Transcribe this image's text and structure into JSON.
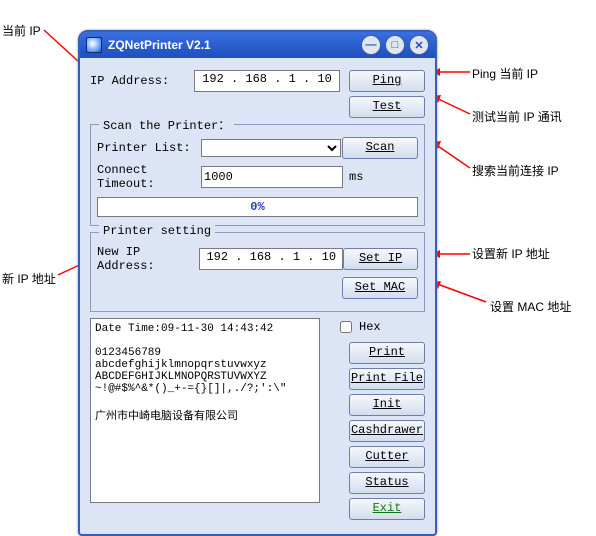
{
  "annotations": {
    "current_ip": "当前 IP",
    "ping_ip": "Ping 当前 IP",
    "test_comm": "测试当前 IP 通讯",
    "scan_ip": "搜索当前连接 IP",
    "new_ip_addr": "新 IP 地址",
    "set_new_ip": "设置新 IP 地址",
    "set_mac": "设置 MAC 地址"
  },
  "window": {
    "title": "ZQNetPrinter V2.1"
  },
  "top": {
    "ip_label": "IP Address:",
    "ip_value": "192 . 168 .  1  .  10",
    "ping_btn": "Ping",
    "test_btn": "Test"
  },
  "scan_group": {
    "legend": "Scan the Printer：",
    "printer_list_label": "Printer List:",
    "printer_list_value": "",
    "timeout_label": "Connect Timeout:",
    "timeout_value": "1000",
    "timeout_unit": "ms",
    "scan_btn": "Scan",
    "progress": "0%"
  },
  "setting_group": {
    "legend": "Printer setting",
    "new_ip_label": "New IP Address:",
    "new_ip_value": "192 . 168 .  1  .  10",
    "set_ip_btn": "Set IP",
    "set_mac_btn": "Set MAC"
  },
  "output": {
    "text": "Date Time:09-11-30 14:43:42\n\n0123456789\nabcdefghijklmnopqrstuvwxyz\nABCDEFGHIJKLMNOPQRSTUVWXYZ\n~!@#$%^&*()_+-={}[]|,./?;':\\\"\n\n广州市中崎电脑设备有限公司",
    "hex_label": "Hex"
  },
  "buttons": {
    "print": "Print",
    "print_file": "Print File",
    "init": "Init",
    "cashdrawer": "Cashdrawer",
    "cutter": "Cutter",
    "status": "Status",
    "exit": "Exit"
  }
}
